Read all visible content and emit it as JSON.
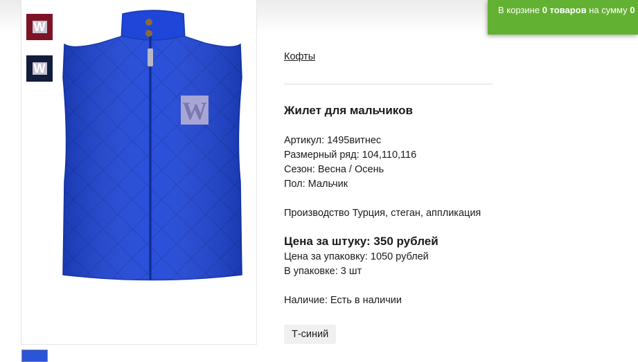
{
  "cart": {
    "prefix": "В корзине",
    "count": "0 товаров",
    "middle": "на сумму",
    "sum": "0"
  },
  "breadcrumb": "Кофты",
  "product": {
    "title": "Жилет для мальчиков",
    "article": "Артикул: 1495витнес",
    "sizes": "Размерный ряд: 104,110,116",
    "season": "Сезон: Весна / Осень",
    "gender": "Пол: Мальчик",
    "production": "Производство Турция, стеган, аппликация",
    "price_per_item": "Цена за штуку: 350 рублей",
    "price_per_pack": "Цена за упаковку: 1050 рублей",
    "pack_qty": "В упаковке: 3 шт",
    "availability": "Наличие: Есть в наличии",
    "color_option": "Т-синий"
  },
  "gallery": {
    "thumbnails": [
      "burgundy-vest-thumb",
      "navy-vest-thumb",
      "blue-vest-thumb"
    ],
    "main_image": "blue-quilted-vest"
  },
  "colors": {
    "cart_bg": "#63b132",
    "vest_blue": "#1f46d8"
  }
}
